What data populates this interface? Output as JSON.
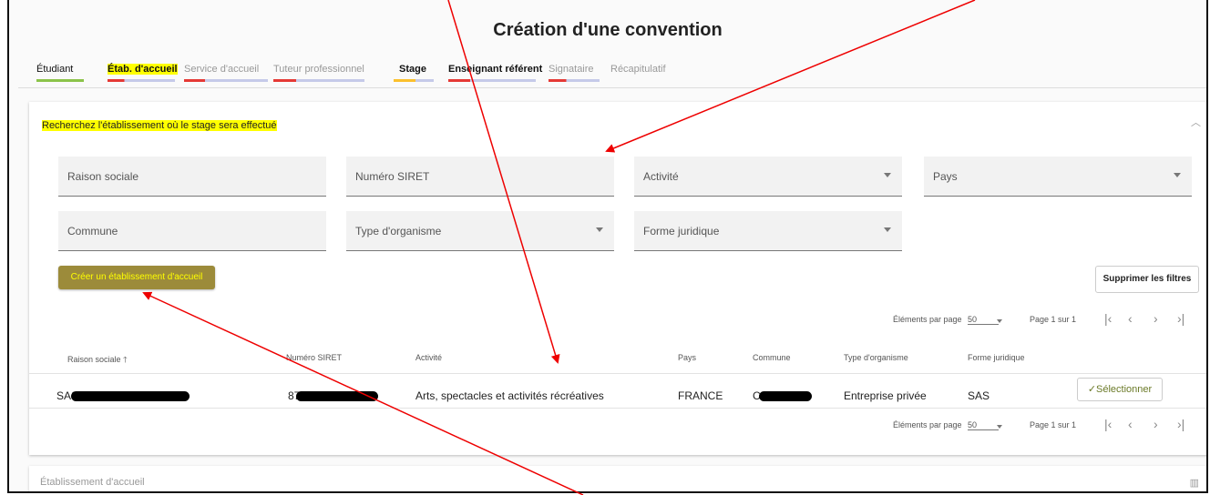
{
  "page_title": "Création d'une convention",
  "steps": [
    {
      "label": "Étudiant",
      "color": "#8bc34a",
      "style": "done"
    },
    {
      "label": "Étab. d'accueil",
      "color": "#e53935",
      "style": "current"
    },
    {
      "label": "Service d'accueil",
      "color": "#e53935",
      "style": "dim"
    },
    {
      "label": "Tuteur professionnel",
      "color": "#e53935",
      "style": "dim"
    },
    {
      "label": "Stage",
      "color": "#fbc02d",
      "style": "bold"
    },
    {
      "label": "Enseignant référent",
      "color": "#e53935",
      "style": "bold"
    },
    {
      "label": "Signataire",
      "color": "#e53935",
      "style": "dim"
    },
    {
      "label": "Récapitulatif",
      "color": "",
      "style": "dim"
    }
  ],
  "search_section": {
    "title": "Recherchez l'établissement où le stage sera effectué",
    "fields": {
      "raison_sociale": "Raison sociale",
      "siret": "Numéro SIRET",
      "activite": "Activité",
      "pays": "Pays",
      "commune": "Commune",
      "type_organisme": "Type d'organisme",
      "forme_juridique": "Forme juridique"
    },
    "create_button": "Créer un établissement d'accueil",
    "clear_filters_button": "Supprimer les filtres"
  },
  "pagination": {
    "per_page_label": "Éléments par page",
    "per_page_value": "50",
    "page_label": "Page 1 sur 1",
    "first": "|‹",
    "prev": "‹",
    "next": "›",
    "last": "›|"
  },
  "table": {
    "headers": {
      "raison_sociale": "Raison sociale",
      "sort_arrow": "🡑",
      "siret": "Numéro SIRET",
      "activite": "Activité",
      "pays": "Pays",
      "commune": "Commune",
      "type_organisme": "Type d'organisme",
      "forme_juridique": "Forme juridique"
    },
    "row": {
      "raison_sociale": "SAS",
      "siret": "87",
      "activite": "Arts, spectacles et activités récréatives",
      "pays": "FRANCE",
      "commune": "C",
      "type_organisme": "Entreprise privée",
      "forme_juridique": "SAS",
      "select_button": "✓Sélectionner"
    }
  },
  "bottom_panel": {
    "title": "Établissement d'accueil"
  },
  "colors": {
    "highlight": "#ffff00",
    "annotation_arrow": "#ee0000",
    "create_button_bg": "#9c8b3a"
  }
}
